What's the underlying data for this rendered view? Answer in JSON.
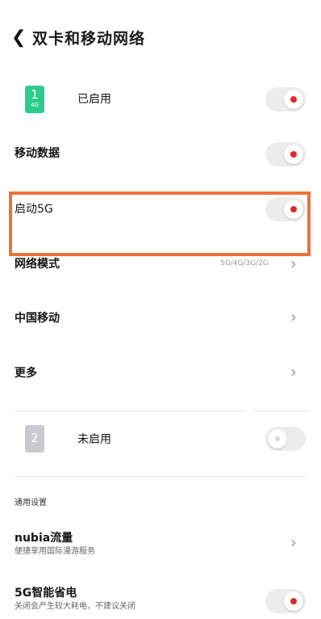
{
  "header": {
    "back_icon": "chevron-left-icon",
    "title": "双卡和移动网络"
  },
  "sim1": {
    "number": "1",
    "network": "4G",
    "status": "已启用",
    "color": "#2ecb8c",
    "toggle_on": true
  },
  "mobile_data": {
    "label": "移动数据",
    "toggle_on": true
  },
  "enable_5g": {
    "label": "启动5G",
    "toggle_on": true
  },
  "network_mode": {
    "label": "网络模式",
    "value": "5G/4G/3G/2G"
  },
  "carrier": {
    "label": "中国移动"
  },
  "more": {
    "label": "更多"
  },
  "sim2": {
    "number": "2",
    "status": "未启用",
    "color": "#c9c9d3",
    "toggle_on": false
  },
  "general": {
    "section_title": "通用设置"
  },
  "nubia_traffic": {
    "title": "nubia流量",
    "subtitle": "便捷享用国际漫游服务"
  },
  "smart_5g": {
    "title": "5G智能省电",
    "subtitle": "关闭会产生较大耗电，不建议关闭",
    "toggle_on": true
  },
  "colors": {
    "highlight": "#f0703c",
    "toggle_dot": "#e02a2a"
  }
}
